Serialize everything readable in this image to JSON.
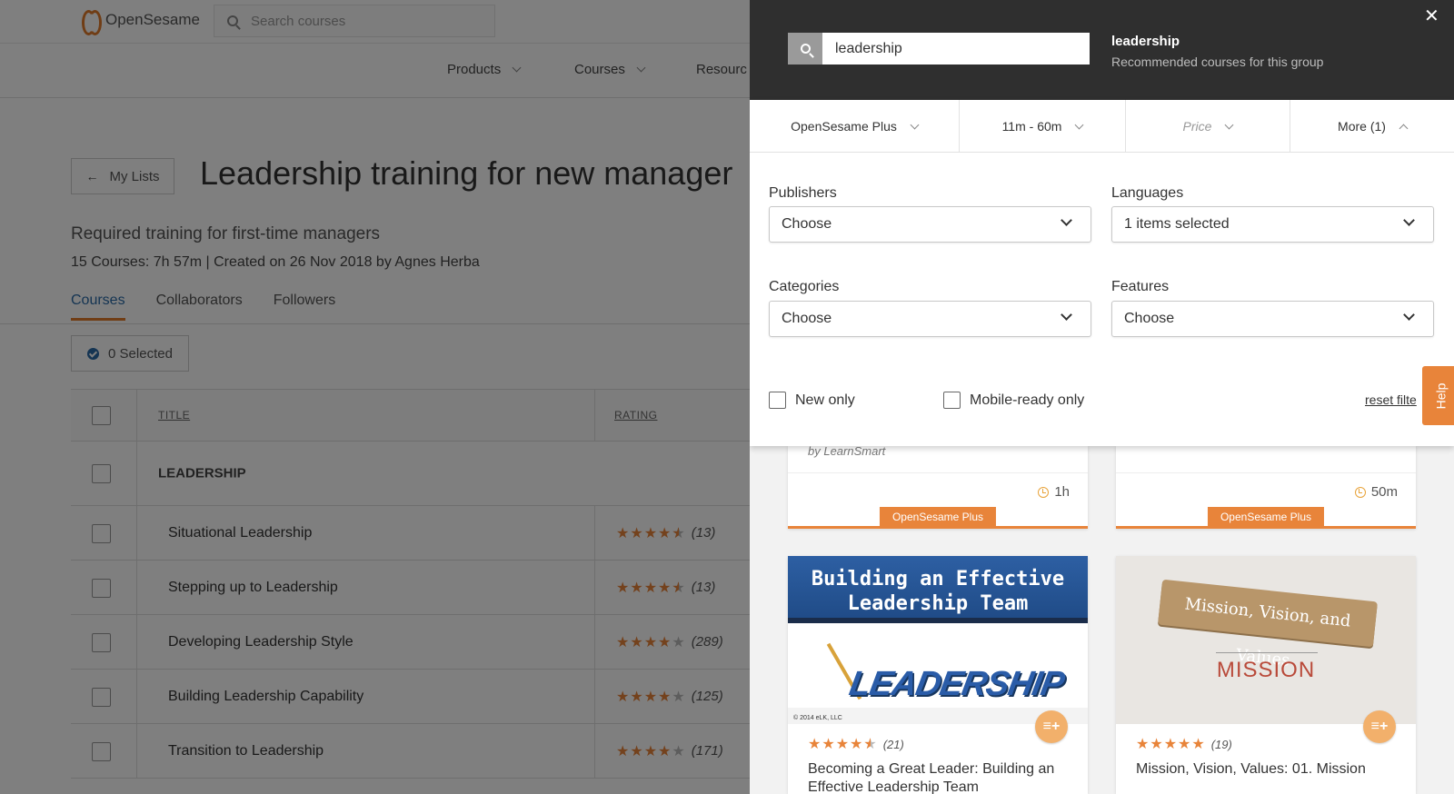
{
  "header": {
    "brand": "OpenSesame",
    "search_placeholder": "Search courses",
    "nav": [
      "Products",
      "Courses",
      "Resourc"
    ]
  },
  "list_page": {
    "back_label": "My Lists",
    "title": "Leadership training for new manager",
    "subtitle": "Required training for first-time managers",
    "meta": "15 Courses: 7h 57m | Created on 26 Nov 2018 by Agnes Herba",
    "tabs": [
      "Courses",
      "Collaborators",
      "Followers"
    ],
    "selected_label": "0 Selected",
    "columns": {
      "title": "TITLE",
      "rating": "RATING"
    },
    "group_label": "LEADERSHIP",
    "rows": [
      {
        "title": "Situational Leadership",
        "rating": 4.5,
        "count": "(13)"
      },
      {
        "title": "Stepping up to Leadership",
        "rating": 4.5,
        "count": "(13)"
      },
      {
        "title": "Developing Leadership Style",
        "rating": 4,
        "count": "(289)"
      },
      {
        "title": "Building Leadership Capability",
        "rating": 4,
        "count": "(125)"
      },
      {
        "title": "Transition to Leadership",
        "rating": 4,
        "count": "(171)"
      }
    ]
  },
  "panel": {
    "search_value": "leadership",
    "heading": "leadership",
    "subheading": "Recommended courses for this group",
    "filter_bar": [
      "OpenSesame Plus",
      "11m - 60m",
      "Price",
      "More (1)"
    ],
    "fields": {
      "publishers": {
        "label": "Publishers",
        "value": "Choose"
      },
      "languages": {
        "label": "Languages",
        "value": "1 items selected"
      },
      "categories": {
        "label": "Categories",
        "value": "Choose"
      },
      "features": {
        "label": "Features",
        "value": "Choose"
      }
    },
    "checkboxes": {
      "new_only": "New only",
      "mobile_ready": "Mobile-ready only"
    },
    "reset_label": "reset filte",
    "help_label": "Help",
    "cards_top": [
      {
        "byline": "by LearnSmart",
        "duration": "1h",
        "badge": "OpenSesame Plus"
      },
      {
        "byline": "",
        "duration": "50m",
        "badge": "OpenSesame Plus"
      }
    ],
    "cards": [
      {
        "thumb_title": "Building an Effective Leadership Team",
        "thumb_word": "LEADERSHIP",
        "thumb_copy": "© 2014 eLK, LLC",
        "rating": 4.5,
        "count": "(21)",
        "title": "Becoming a Great Leader: Building an Effective Leadership Team"
      },
      {
        "thumb_title": "Mission, Vision, and Values",
        "thumb_word": "MISSION",
        "rating": 5,
        "count": "(19)",
        "title": "Mission, Vision, Values: 01. Mission"
      }
    ]
  },
  "colors": {
    "accent": "#e8843a",
    "link": "#2b6aa7",
    "panel_header": "#2f2f2f"
  }
}
